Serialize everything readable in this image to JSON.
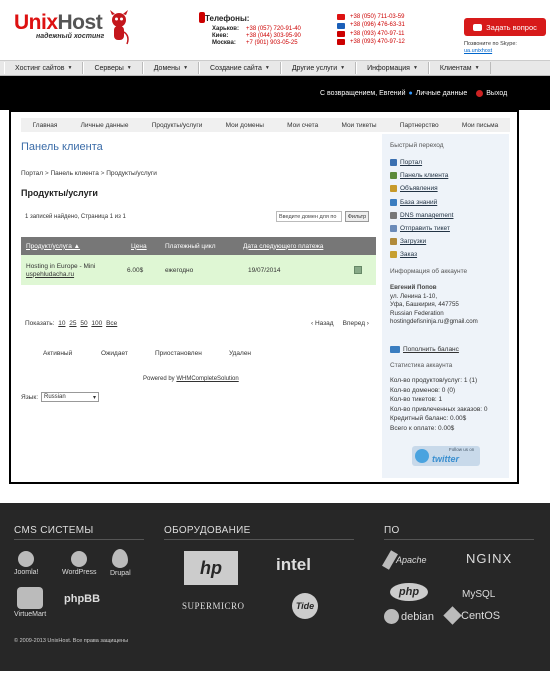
{
  "header": {
    "logo_unix": "Unix",
    "logo_host": "Host",
    "slogan": "надежный хостинг",
    "phones_title": "Телефоны:",
    "cities": [
      {
        "city": "Харьков:",
        "phone": "+38 (057) 720-91-40"
      },
      {
        "city": "Киев:",
        "phone": "+38 (044) 303-95-90"
      },
      {
        "city": "Москва:",
        "phone": "+7 (901) 903-05-25"
      }
    ],
    "mobiles": [
      {
        "phone": "+38 (050) 711-03-59",
        "color": "#d11"
      },
      {
        "phone": "+38 (096) 476-63-31",
        "color": "#1b5fb8"
      },
      {
        "phone": "+38 (093) 470-97-11",
        "color": "#c00"
      },
      {
        "phone": "+38 (093) 470-97-12",
        "color": "#c00"
      }
    ],
    "ask_button": "Задать вопрос",
    "skype_label": "Позвоните по Skype:",
    "skype_link": "ua.unixhost"
  },
  "topmenu": [
    "Хостинг сайтов",
    "Серверы",
    "Домены",
    "Создание сайта",
    "Другие услуги",
    "Информация",
    "Клиентам"
  ],
  "welcome": {
    "greeting": "С возвращением, Евгений",
    "personal": "Личные данные",
    "logout": "Выход"
  },
  "subnav": [
    "Главная",
    "Личные данные",
    "Продукты/услуги",
    "Мои домены",
    "Мои счета",
    "Мои тикеты",
    "Партнерство",
    "Мои письма"
  ],
  "main": {
    "title": "Панель клиента",
    "crumbs": [
      "Портал",
      "Панель клиента",
      "Продукты/услуги"
    ],
    "heading": "Продукты/услуги",
    "found": "1 записей найдено, Страница 1 из 1",
    "filter_placeholder": "Введите домен для по",
    "filter_button": "Фильтр",
    "columns": [
      "Продукт/услуга ▲",
      "Цена",
      "Платежный цикл",
      "Дата следующего платежа"
    ],
    "rows": [
      {
        "product": "Hosting in Europe - Mini",
        "domain": "uspehludacha.ru",
        "price": "6.00$",
        "cycle": "ежегодно",
        "date": "19/07/2014"
      }
    ],
    "show_label": "Показать:",
    "show_options": [
      "10",
      "25",
      "50",
      "100",
      "Все"
    ],
    "prev": "‹ Назад",
    "next": "Вперед ›",
    "statuses": [
      "Активный",
      "Ожидает",
      "Приостановлен",
      "Удален"
    ],
    "powered_prefix": "Powered by",
    "powered_link": "WHMCompleteSolution",
    "lang_label": "Язык:",
    "lang_value": "Russian"
  },
  "sidebar": {
    "quick_title": "Быстрый переход",
    "links": [
      {
        "label": "Портал",
        "color": "#3a6fb0"
      },
      {
        "label": "Панель клиента",
        "color": "#5c8a3a"
      },
      {
        "label": "Объявления",
        "color": "#c79a2a"
      },
      {
        "label": "База знаний",
        "color": "#3a7dc0"
      },
      {
        "label": "DNS management",
        "color": "#777"
      },
      {
        "label": "Отправить тикет",
        "color": "#6a8ab8"
      },
      {
        "label": "Загрузки",
        "color": "#b08a3a"
      },
      {
        "label": "Заказ",
        "color": "#c7a030"
      }
    ],
    "account_title": "Информация об аккаунте",
    "account": {
      "name": "Евгений Попов",
      "address1": "ул. Ленина 1-10,",
      "address2": "Уфа, Башкирия, 447755",
      "country": "Russian Federation",
      "email": "hostingdefisninja.ru@gmail.com"
    },
    "topup": "Пополнить баланс",
    "stats_title": "Статистика аккаунта",
    "stats": [
      "Кол-во продуктов/услуг: 1 (1)",
      "Кол-во доменов: 0 (0)",
      "Кол-во тикетов: 1",
      "Кол-во привлеченных заказов: 0",
      "Кредитный баланс: 0.00$",
      "Всего к оплате: 0.00$"
    ],
    "twitter_follow": "Follow us on",
    "twitter_word": "twitter"
  },
  "footer": {
    "cms_title": "CMS СИСТЕМЫ",
    "hw_title": "ОБОРУДОВАНИЕ",
    "sw_title": "ПО",
    "cms": [
      "Joomla!",
      "WordPress",
      "Drupal",
      "VirtueMart",
      "phpBB"
    ],
    "hw": [
      "hp",
      "intel",
      "SUPERMICRO",
      "Tide"
    ],
    "sw": [
      "Apache",
      "NGINX",
      "php",
      "MySQL",
      "debian",
      "CentOS"
    ],
    "copyright": "© 2009-2013 UnixHost. Все права защищены"
  }
}
